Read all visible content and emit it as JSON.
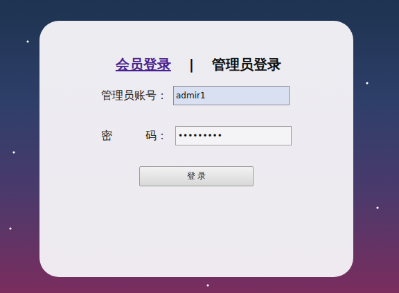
{
  "tabs": [
    {
      "label": "会员登录",
      "selected": false
    },
    {
      "label": "管理员登录",
      "selected": true
    }
  ],
  "separator": "|",
  "fields": [
    {
      "label": "管理员账号：",
      "value": "admir1",
      "highlighted": true
    },
    {
      "label": "密　　　码：",
      "value": "•••••••••",
      "highlighted": false
    }
  ],
  "button": "登 录"
}
